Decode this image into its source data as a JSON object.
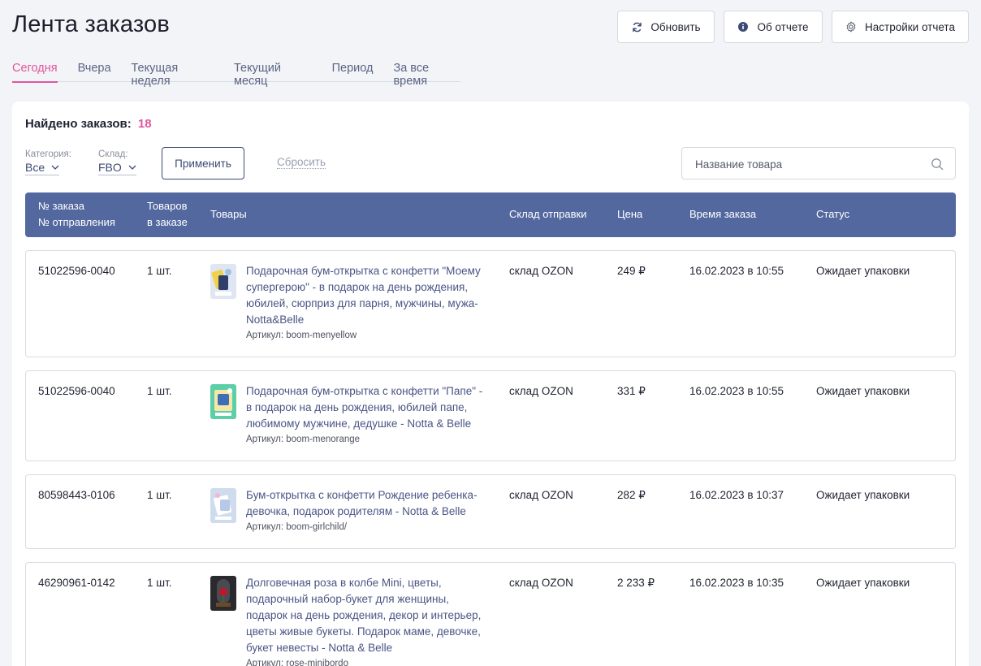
{
  "header": {
    "title": "Лента заказов",
    "buttons": {
      "refresh": "Обновить",
      "about": "Об отчете",
      "settings": "Настройки отчета"
    }
  },
  "tabs": [
    {
      "label": "Сегодня",
      "active": true
    },
    {
      "label": "Вчера",
      "active": false
    },
    {
      "label": "Текущая неделя",
      "active": false
    },
    {
      "label": "Текущий месяц",
      "active": false
    },
    {
      "label": "Период",
      "active": false
    },
    {
      "label": "За все время",
      "active": false
    }
  ],
  "summary": {
    "found_label": "Найдено заказов:",
    "found_count": "18"
  },
  "filters": {
    "category_label": "Категория:",
    "category_value": "Все",
    "warehouse_label": "Склад:",
    "warehouse_value": "FBO",
    "apply": "Применить",
    "reset": "Сбросить",
    "search_placeholder": "Название товара"
  },
  "table": {
    "headers": {
      "order_line1": "№ заказа",
      "order_line2": "№ отправления",
      "qty_line1": "Товаров",
      "qty_line2": "в заказе",
      "products": "Товары",
      "warehouse": "Склад отправки",
      "price": "Цена",
      "time": "Время заказа",
      "status": "Статус"
    },
    "rows": [
      {
        "order": "51022596-0040",
        "qty": "1 шт.",
        "product": "Подарочная бум-открытка с конфетти \"Моему супергерою\" - в подарок на день рождения, юбилей, сюрприз для парня, мужчины, мужа- Notta&Belle",
        "sku": "Артикул: boom-menyellow",
        "warehouse": "склад OZON",
        "price": "249 ₽",
        "time": "16.02.2023 в 10:55",
        "status": "Ожидает упаковки"
      },
      {
        "order": "51022596-0040",
        "qty": "1 шт.",
        "product": "Подарочная бум-открытка с конфетти \"Папе\" - в подарок на день рождения, юбилей папе, любимому мужчине, дедушке - Notta & Belle",
        "sku": "Артикул: boom-menorange",
        "warehouse": "склад OZON",
        "price": "331 ₽",
        "time": "16.02.2023 в 10:55",
        "status": "Ожидает упаковки"
      },
      {
        "order": "80598443-0106",
        "qty": "1 шт.",
        "product": "Бум-открытка с конфетти Рождение ребенка-девочка, подарок родителям - Notta & Belle",
        "sku": "Артикул: boom-girlchild/",
        "warehouse": "склад OZON",
        "price": "282 ₽",
        "time": "16.02.2023 в 10:37",
        "status": "Ожидает упаковки"
      },
      {
        "order": "46290961-0142",
        "qty": "1 шт.",
        "product": "Долговечная роза в колбе Mini, цветы, подарочный набор-букет для женщины, подарок на день рождения, декор и интерьер, цветы живые букеты. Подарок маме, девочке, букет невесты - Notta & Belle",
        "sku": "Артикул: rose-minibordo",
        "warehouse": "склад OZON",
        "price": "2 233 ₽",
        "time": "16.02.2023 в 10:35",
        "status": "Ожидает упаковки"
      }
    ]
  },
  "colors": {
    "accent": "#e0569e",
    "header_bg": "#5468a0",
    "link": "#4a5585"
  },
  "icons": {
    "refresh": "refresh-icon",
    "about": "info-icon",
    "settings": "gear-icon",
    "search": "search-icon",
    "dropdown": "chevron-down-icon"
  }
}
